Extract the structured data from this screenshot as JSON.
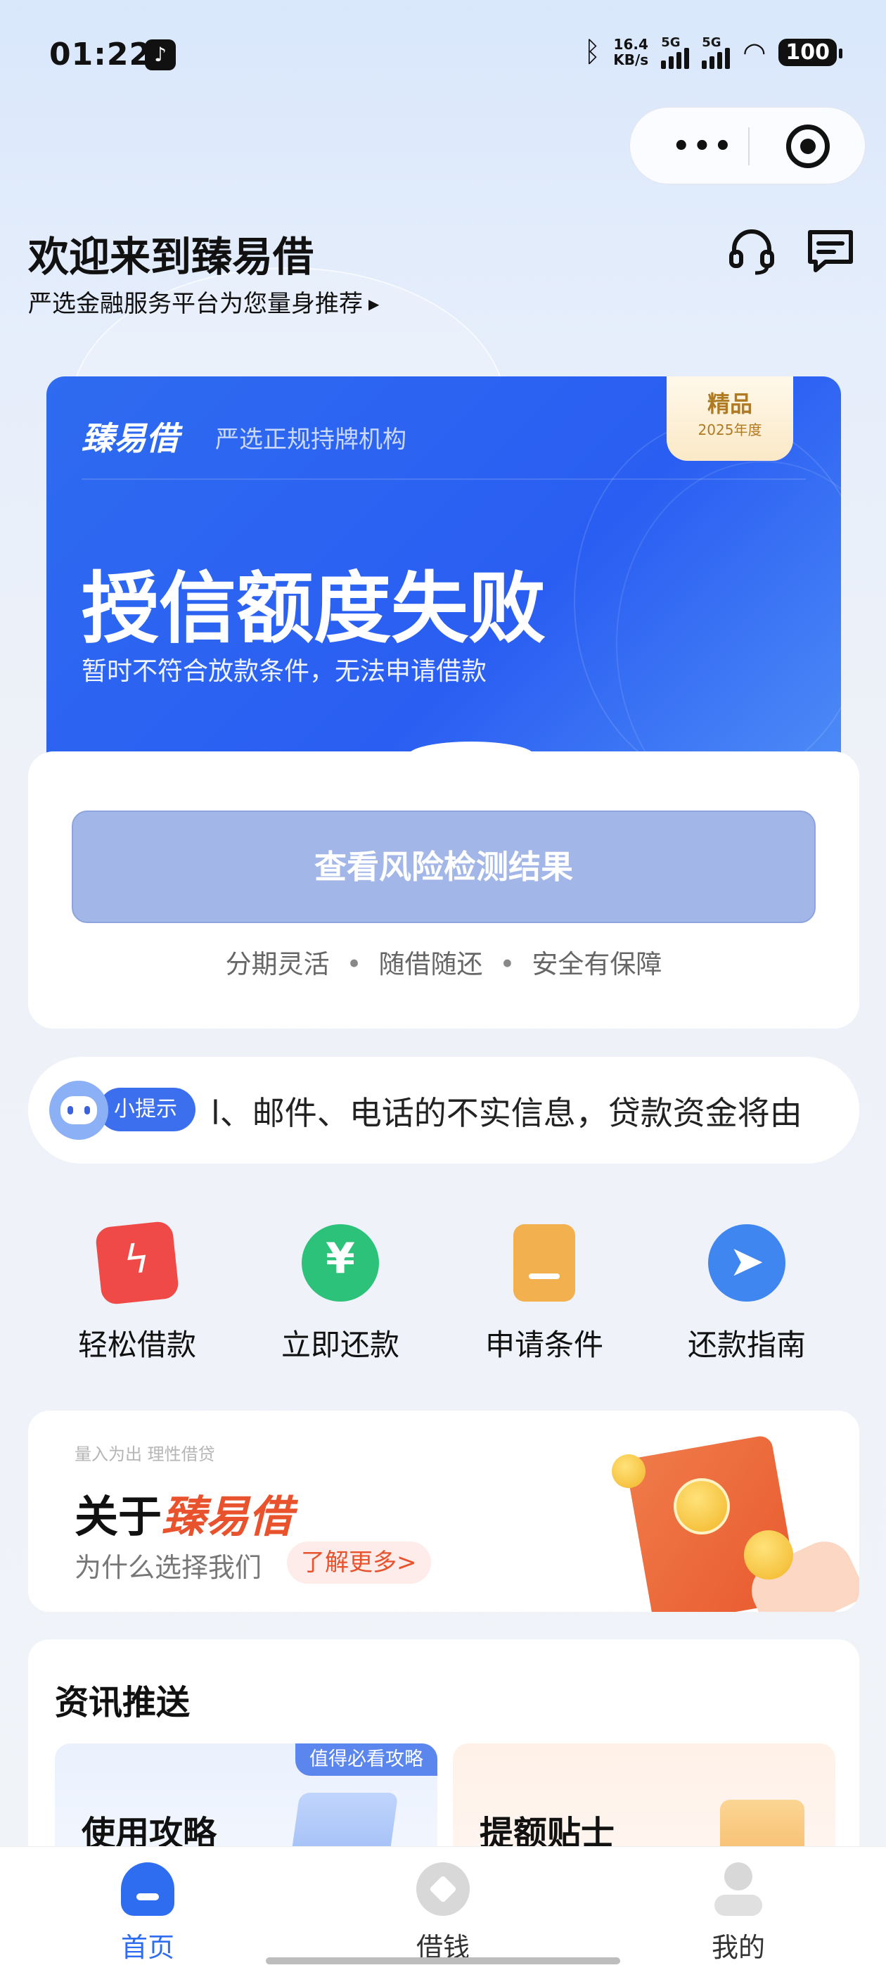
{
  "status_bar": {
    "time": "01:22",
    "speed_value": "16.4",
    "speed_unit": "KB/s",
    "signal1_label": "5G",
    "signal2_label": "5G",
    "battery": "100"
  },
  "header": {
    "title": "欢迎来到臻易借",
    "subtitle": "严选金融服务平台为您量身推荐"
  },
  "banner": {
    "brand": "臻易借",
    "slogan": "严选正规持牌机构",
    "badge_title": "精品",
    "badge_year": "2025年度",
    "status_title": "授信额度失败",
    "status_desc": "暂时不符合放款条件，无法申请借款"
  },
  "risk_card": {
    "button_label": "查看风险检测结果",
    "features": [
      "分期灵活",
      "随借随还",
      "安全有保障"
    ],
    "separator": "•"
  },
  "tips": {
    "tag": "小提示",
    "text": "l、邮件、电话的不实信息，贷款资金将由"
  },
  "actions": [
    {
      "label": "轻松借款",
      "icon": "lightning-icon",
      "color": "#ef4a47"
    },
    {
      "label": "立即还款",
      "icon": "yen-icon",
      "color": "#2cc27a"
    },
    {
      "label": "申请条件",
      "icon": "document-icon",
      "color": "#f3b04f"
    },
    {
      "label": "还款指南",
      "icon": "compass-icon",
      "color": "#3f86f1"
    }
  ],
  "about": {
    "small": "量入为出 理性借贷",
    "title_prefix": "关于",
    "title_brand": "臻易借",
    "subtitle": "为什么选择我们",
    "link": "了解更多>"
  },
  "news": {
    "title": "资讯推送",
    "items": [
      {
        "title": "使用攻略",
        "tag": "值得必看攻略"
      },
      {
        "title": "提额贴士",
        "tag": ""
      }
    ]
  },
  "tabbar": {
    "items": [
      {
        "label": "首页",
        "active": true
      },
      {
        "label": "借钱",
        "active": false
      },
      {
        "label": "我的",
        "active": false
      }
    ]
  },
  "colors": {
    "primary": "#2f6df0",
    "accent": "#e8522d",
    "button_disabled": "#a2b6e8"
  }
}
